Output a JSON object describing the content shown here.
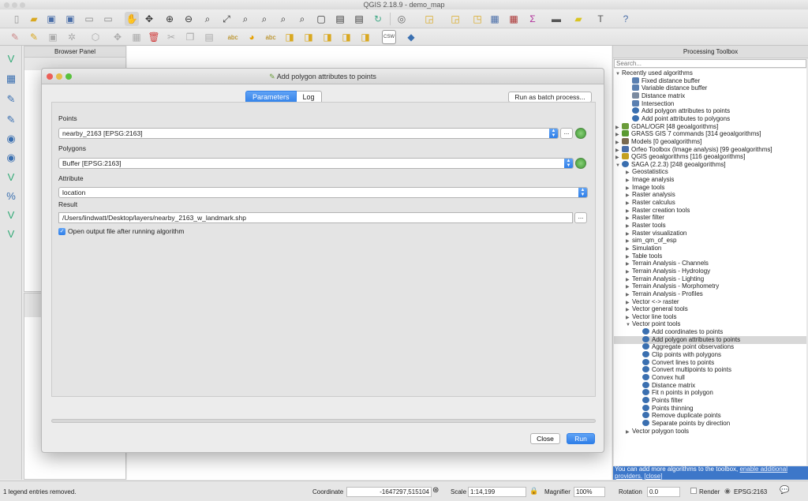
{
  "window": {
    "title": "QGIS 2.18.9 - demo_map"
  },
  "browser_panel": {
    "title": "Browser Panel"
  },
  "processing_toolbox": {
    "title": "Processing Toolbox",
    "search_placeholder": "Search...",
    "items": [
      {
        "label": "Recently used algorithms",
        "level": 0,
        "arrow": "down",
        "icon": "none"
      },
      {
        "label": "Fixed distance buffer",
        "level": 1,
        "icon": "buffer"
      },
      {
        "label": "Variable distance buffer",
        "level": 1,
        "icon": "buffer"
      },
      {
        "label": "Distance matrix",
        "level": 1,
        "icon": "matrix"
      },
      {
        "label": "Intersection",
        "level": 1,
        "icon": "intersect"
      },
      {
        "label": "Add polygon attributes to points",
        "level": 1,
        "icon": "saga"
      },
      {
        "label": "Add point attributes to polygons",
        "level": 1,
        "icon": "saga"
      },
      {
        "label": "GDAL/OGR [48 geoalgorithms]",
        "level": 0,
        "arrow": "right",
        "icon": "gdal"
      },
      {
        "label": "GRASS GIS 7 commands [314 geoalgorithms]",
        "level": 0,
        "arrow": "right",
        "icon": "grass"
      },
      {
        "label": "Models [0 geoalgorithms]",
        "level": 0,
        "arrow": "right",
        "icon": "models"
      },
      {
        "label": "Orfeo Toolbox (Image analysis) [99 geoalgorithms]",
        "level": 0,
        "arrow": "right",
        "icon": "orfeo"
      },
      {
        "label": "QGIS geoalgorithms [116 geoalgorithms]",
        "level": 0,
        "arrow": "right",
        "icon": "qgis"
      },
      {
        "label": "SAGA (2.2.3) [248 geoalgorithms]",
        "level": 0,
        "arrow": "down",
        "icon": "saga"
      },
      {
        "label": "Geostatistics",
        "level": 1,
        "arrow": "right",
        "icon": "none"
      },
      {
        "label": "Image analysis",
        "level": 1,
        "arrow": "right",
        "icon": "none"
      },
      {
        "label": "Image tools",
        "level": 1,
        "arrow": "right",
        "icon": "none"
      },
      {
        "label": "Raster analysis",
        "level": 1,
        "arrow": "right",
        "icon": "none"
      },
      {
        "label": "Raster calculus",
        "level": 1,
        "arrow": "right",
        "icon": "none"
      },
      {
        "label": "Raster creation tools",
        "level": 1,
        "arrow": "right",
        "icon": "none"
      },
      {
        "label": "Raster filter",
        "level": 1,
        "arrow": "right",
        "icon": "none"
      },
      {
        "label": "Raster tools",
        "level": 1,
        "arrow": "right",
        "icon": "none"
      },
      {
        "label": "Raster visualization",
        "level": 1,
        "arrow": "right",
        "icon": "none"
      },
      {
        "label": "sim_qm_of_esp",
        "level": 1,
        "arrow": "right",
        "icon": "none"
      },
      {
        "label": "Simulation",
        "level": 1,
        "arrow": "right",
        "icon": "none"
      },
      {
        "label": "Table tools",
        "level": 1,
        "arrow": "right",
        "icon": "none"
      },
      {
        "label": "Terrain Analysis - Channels",
        "level": 1,
        "arrow": "right",
        "icon": "none"
      },
      {
        "label": "Terrain Analysis - Hydrology",
        "level": 1,
        "arrow": "right",
        "icon": "none"
      },
      {
        "label": "Terrain Analysis - Lighting",
        "level": 1,
        "arrow": "right",
        "icon": "none"
      },
      {
        "label": "Terrain Analysis - Morphometry",
        "level": 1,
        "arrow": "right",
        "icon": "none"
      },
      {
        "label": "Terrain Analysis - Profiles",
        "level": 1,
        "arrow": "right",
        "icon": "none"
      },
      {
        "label": "Vector <-> raster",
        "level": 1,
        "arrow": "right",
        "icon": "none"
      },
      {
        "label": "Vector general tools",
        "level": 1,
        "arrow": "right",
        "icon": "none"
      },
      {
        "label": "Vector line tools",
        "level": 1,
        "arrow": "right",
        "icon": "none"
      },
      {
        "label": "Vector point tools",
        "level": 1,
        "arrow": "down",
        "icon": "none"
      },
      {
        "label": "Add coordinates to points",
        "level": 2,
        "icon": "saga"
      },
      {
        "label": "Add polygon attributes to points",
        "level": 2,
        "icon": "saga",
        "selected": true
      },
      {
        "label": "Aggregate point observations",
        "level": 2,
        "icon": "saga"
      },
      {
        "label": "Clip points with polygons",
        "level": 2,
        "icon": "saga"
      },
      {
        "label": "Convert lines to points",
        "level": 2,
        "icon": "saga"
      },
      {
        "label": "Convert multipoints to points",
        "level": 2,
        "icon": "saga"
      },
      {
        "label": "Convex hull",
        "level": 2,
        "icon": "saga"
      },
      {
        "label": "Distance matrix",
        "level": 2,
        "icon": "saga"
      },
      {
        "label": "Fit n points in polygon",
        "level": 2,
        "icon": "saga"
      },
      {
        "label": "Points filter",
        "level": 2,
        "icon": "saga"
      },
      {
        "label": "Points thinning",
        "level": 2,
        "icon": "saga"
      },
      {
        "label": "Remove duplicate points",
        "level": 2,
        "icon": "saga"
      },
      {
        "label": "Separate points by direction",
        "level": 2,
        "icon": "saga"
      },
      {
        "label": "Vector polygon tools",
        "level": 1,
        "arrow": "right",
        "icon": "none"
      }
    ],
    "footer_text": "You can add more algorithms to the toolbox,",
    "footer_link1": "enable additional",
    "footer_text2": "providers.",
    "footer_link2": "[close]"
  },
  "dialog": {
    "title": "Add polygon attributes to points",
    "tab_parameters": "Parameters",
    "tab_log": "Log",
    "batch_button": "Run as batch process...",
    "points_label": "Points",
    "points_value": "nearby_2163 [EPSG:2163]",
    "polygons_label": "Polygons",
    "polygons_value": "Buffer [EPSG:2163]",
    "attribute_label": "Attribute",
    "attribute_value": "location",
    "result_label": "Result",
    "result_value": "/Users/lindwatt/Desktop/layers/nearby_2163_w_landmark.shp",
    "open_output_label": "Open output file after running algorithm",
    "browse_label": "...",
    "close_button": "Close",
    "run_button": "Run"
  },
  "statusbar": {
    "message": "1 legend entries removed.",
    "coordinate_label": "Coordinate",
    "coordinate_value": "-1647297,515104",
    "scale_label": "Scale",
    "scale_value": "1:14,199",
    "magnifier_label": "Magnifier",
    "magnifier_value": "100%",
    "rotation_label": "Rotation",
    "rotation_value": "0.0",
    "render_label": "Render",
    "crs_value": "EPSG:2163"
  },
  "colors": {
    "accent": "#2f7fe8",
    "footer_bg": "#3d77c9",
    "selection": "#d8d8d8"
  }
}
